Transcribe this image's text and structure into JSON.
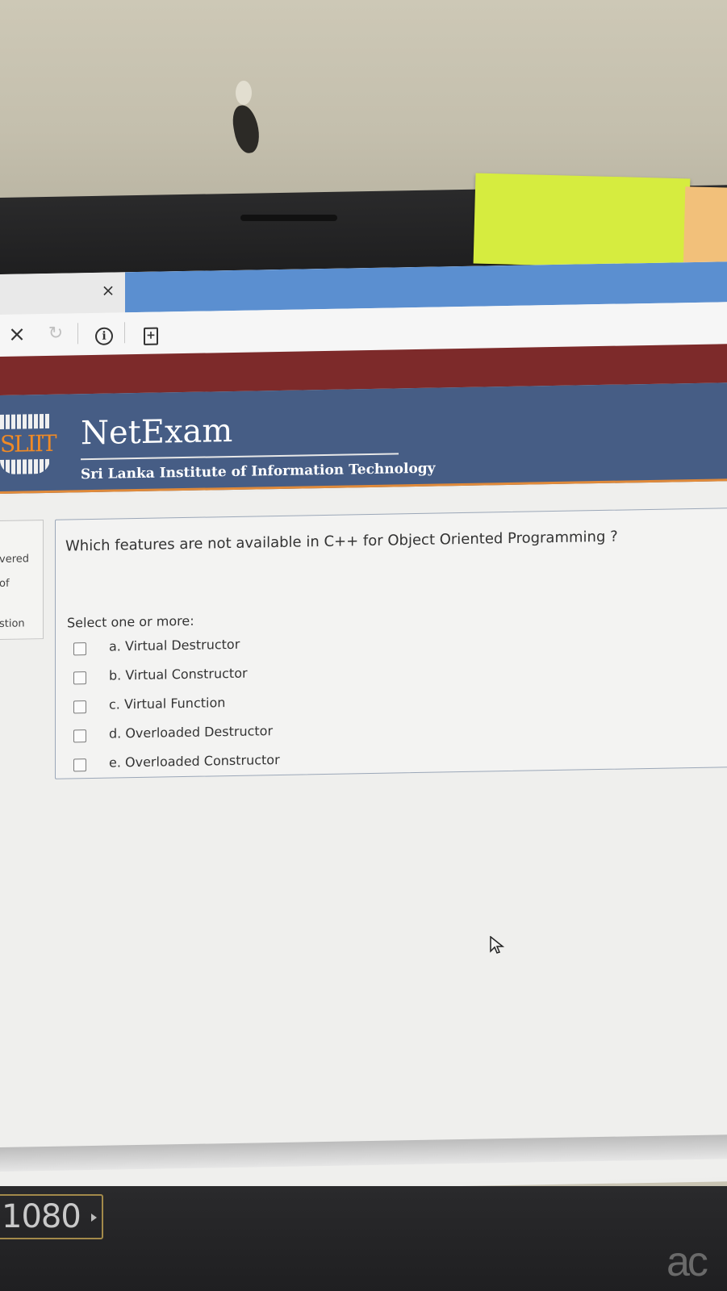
{
  "browser": {
    "tab_close_label": "×",
    "stop_label": "×",
    "reload_label": "↻",
    "info_label": "i",
    "page_label": "+"
  },
  "header": {
    "logo_text": "SLIIT",
    "title": "NetExam",
    "subtitle": "Sri Lanka Institute of Information Technology"
  },
  "side_panel": {
    "lines": [
      "",
      "vered",
      "of",
      "stion"
    ]
  },
  "question": {
    "text": "Which features are not available in C++ for Object Oriented Programming ?",
    "prompt": "Select one or more:",
    "options": [
      {
        "label": "a. Virtual Destructor",
        "checked": false
      },
      {
        "label": "b. Virtual Constructor",
        "checked": false
      },
      {
        "label": "c. Virtual Function",
        "checked": false
      },
      {
        "label": "d. Overloaded Destructor",
        "checked": false
      },
      {
        "label": "e. Overloaded Constructor",
        "checked": false
      }
    ]
  },
  "monitor": {
    "resolution_badge": "1080",
    "brand": "ac"
  },
  "colors": {
    "header_blue": "#465d85",
    "maroon_bar": "#7d2a2a",
    "tab_blue": "#5b8fd0",
    "accent_orange": "#e08a3a",
    "sticky_note": "#d6ec3f"
  }
}
